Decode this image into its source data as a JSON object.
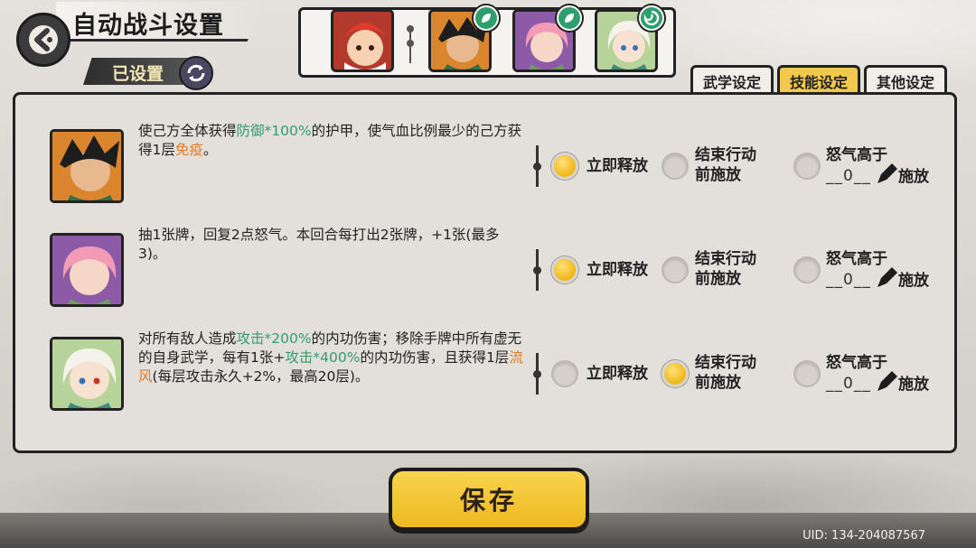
{
  "header": {
    "title": "自动战斗设置",
    "configured_label": "已设置"
  },
  "team": [
    {
      "name": "portrait-red-lion"
    },
    {
      "name": "portrait-green-warrior",
      "element": "leaf"
    },
    {
      "name": "portrait-pink-girl",
      "element": "leaf"
    },
    {
      "name": "portrait-white-girl",
      "element": "wind"
    }
  ],
  "tabs": [
    {
      "label": "武学设定",
      "active": false
    },
    {
      "label": "技能设定",
      "active": true
    },
    {
      "label": "其他设定",
      "active": false
    }
  ],
  "options": {
    "immediate": "立即释放",
    "before_end_1": "结束行动",
    "before_end_2": "前施放",
    "rage_1": "怒气高于",
    "rage_2": "施放"
  },
  "skills": [
    {
      "desc_parts": [
        "使己方全体获得",
        "防御*100%",
        "的护甲，使气血比例最少的己方获得1层",
        "免疫",
        "。"
      ],
      "selected": "immediate",
      "rage_value": "0"
    },
    {
      "desc_parts": [
        "抽1张牌，回复2点怒气。本回合每打出2张牌，+1张(最多3)。"
      ],
      "selected": "immediate",
      "rage_value": "0"
    },
    {
      "desc_parts": [
        "对所有敌人造成",
        "攻击*200%",
        "的内功伤害；移除手牌中所有虚无的自身武学，每有1张+",
        "攻击*400%",
        "的内功伤害，且获得1层",
        "流风",
        "(每层攻击永久+2%，最高20层)。"
      ],
      "selected": "before_end",
      "rage_value": "0"
    }
  ],
  "save_label": "保存",
  "uid": "UID: 134-204087567",
  "colors": {
    "accent": "#f2c94c",
    "highlight_green": "#2f9e6d",
    "highlight_orange": "#e07a26"
  }
}
